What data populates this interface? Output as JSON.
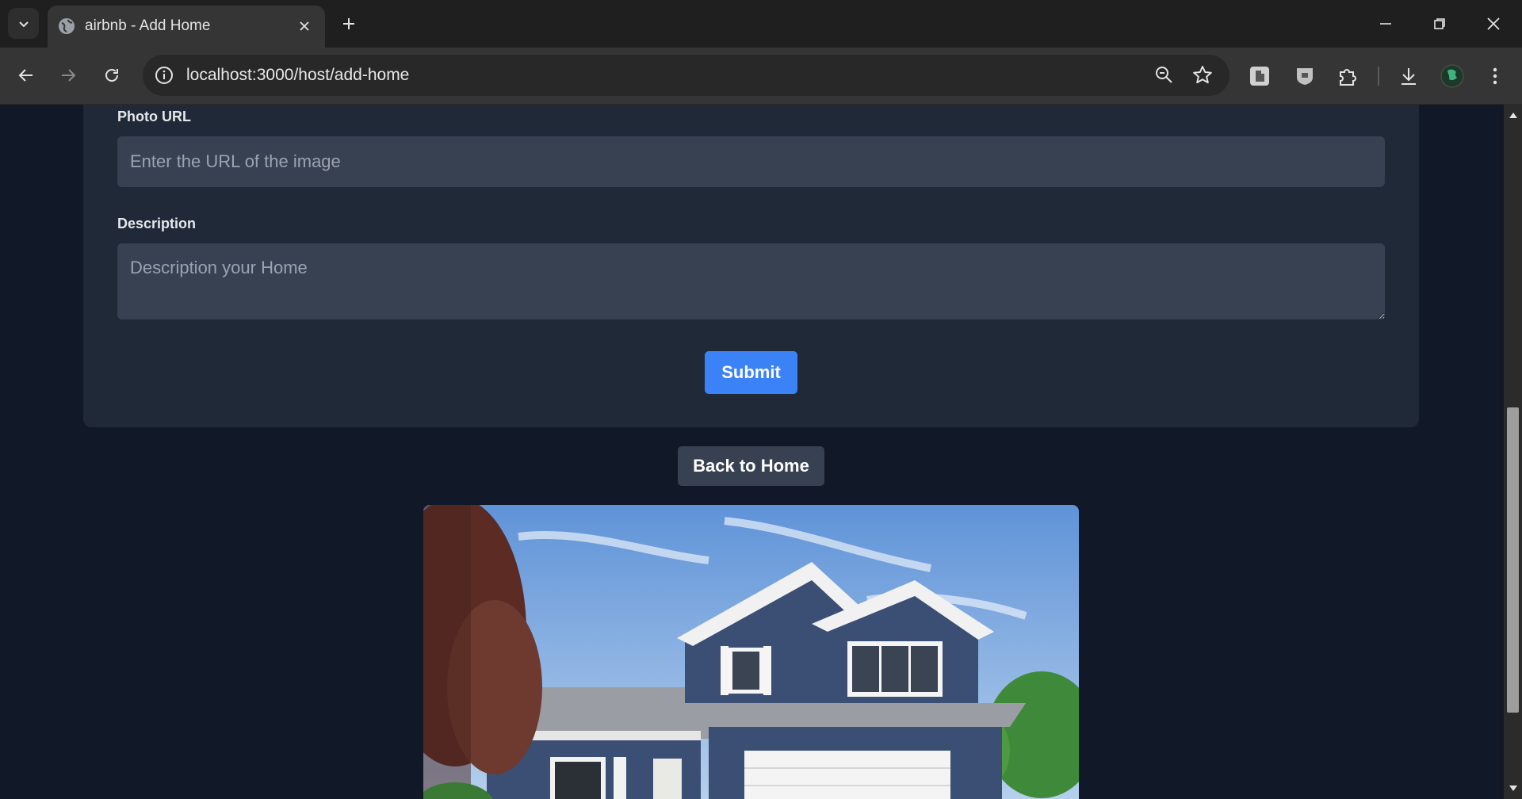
{
  "browser": {
    "tab_title": "airbnb - Add Home",
    "url_host": "localhost",
    "url_rest": ":3000/host/add-home"
  },
  "form": {
    "photo_label": "Photo URL",
    "photo_placeholder": "Enter the URL of the image",
    "description_label": "Description",
    "description_placeholder": "Description your Home",
    "submit_label": "Submit"
  },
  "back_label": "Back to Home",
  "colors": {
    "page_bg": "#111827",
    "card_bg": "#1f2937",
    "input_bg": "#374151",
    "primary": "#3b82f6"
  }
}
